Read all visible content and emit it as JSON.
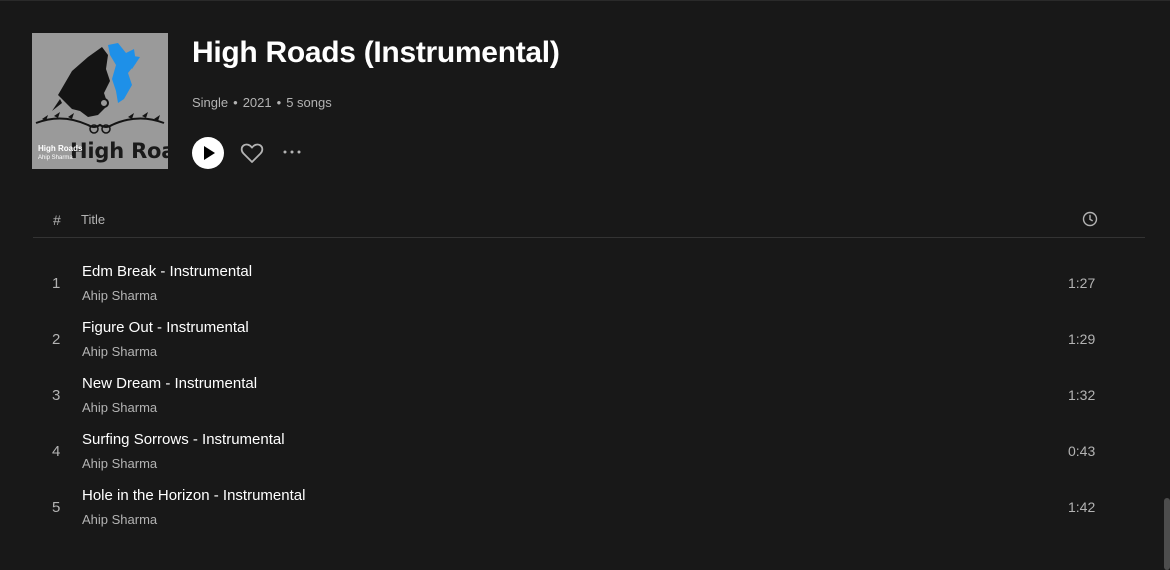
{
  "album": {
    "cover_title": "High Roads",
    "cover_small_title": "High Roads",
    "cover_small_artist": "Ahip Sharma",
    "title": "High Roads (Instrumental)",
    "type": "Single",
    "year": "2021",
    "song_count": "5 songs"
  },
  "icons": {
    "play": "play-icon",
    "like": "heart-icon",
    "more": "more-dots-icon",
    "duration": "clock-icon"
  },
  "table_header": {
    "number": "#",
    "title": "Title"
  },
  "tracks": [
    {
      "number": "1",
      "title": "Edm Break - Instrumental",
      "artist": "Ahip Sharma",
      "duration": "1:27"
    },
    {
      "number": "2",
      "title": "Figure Out - Instrumental",
      "artist": "Ahip Sharma",
      "duration": "1:29"
    },
    {
      "number": "3",
      "title": "New Dream - Instrumental",
      "artist": "Ahip Sharma",
      "duration": "1:32"
    },
    {
      "number": "4",
      "title": "Surfing Sorrows - Instrumental",
      "artist": "Ahip Sharma",
      "duration": "0:43"
    },
    {
      "number": "5",
      "title": "Hole in the Horizon - Instrumental",
      "artist": "Ahip Sharma",
      "duration": "1:42"
    }
  ],
  "colors": {
    "background": "#181818",
    "text_primary": "#ffffff",
    "text_secondary": "#b3b3b3",
    "cover_accent": "#1e90e8"
  }
}
